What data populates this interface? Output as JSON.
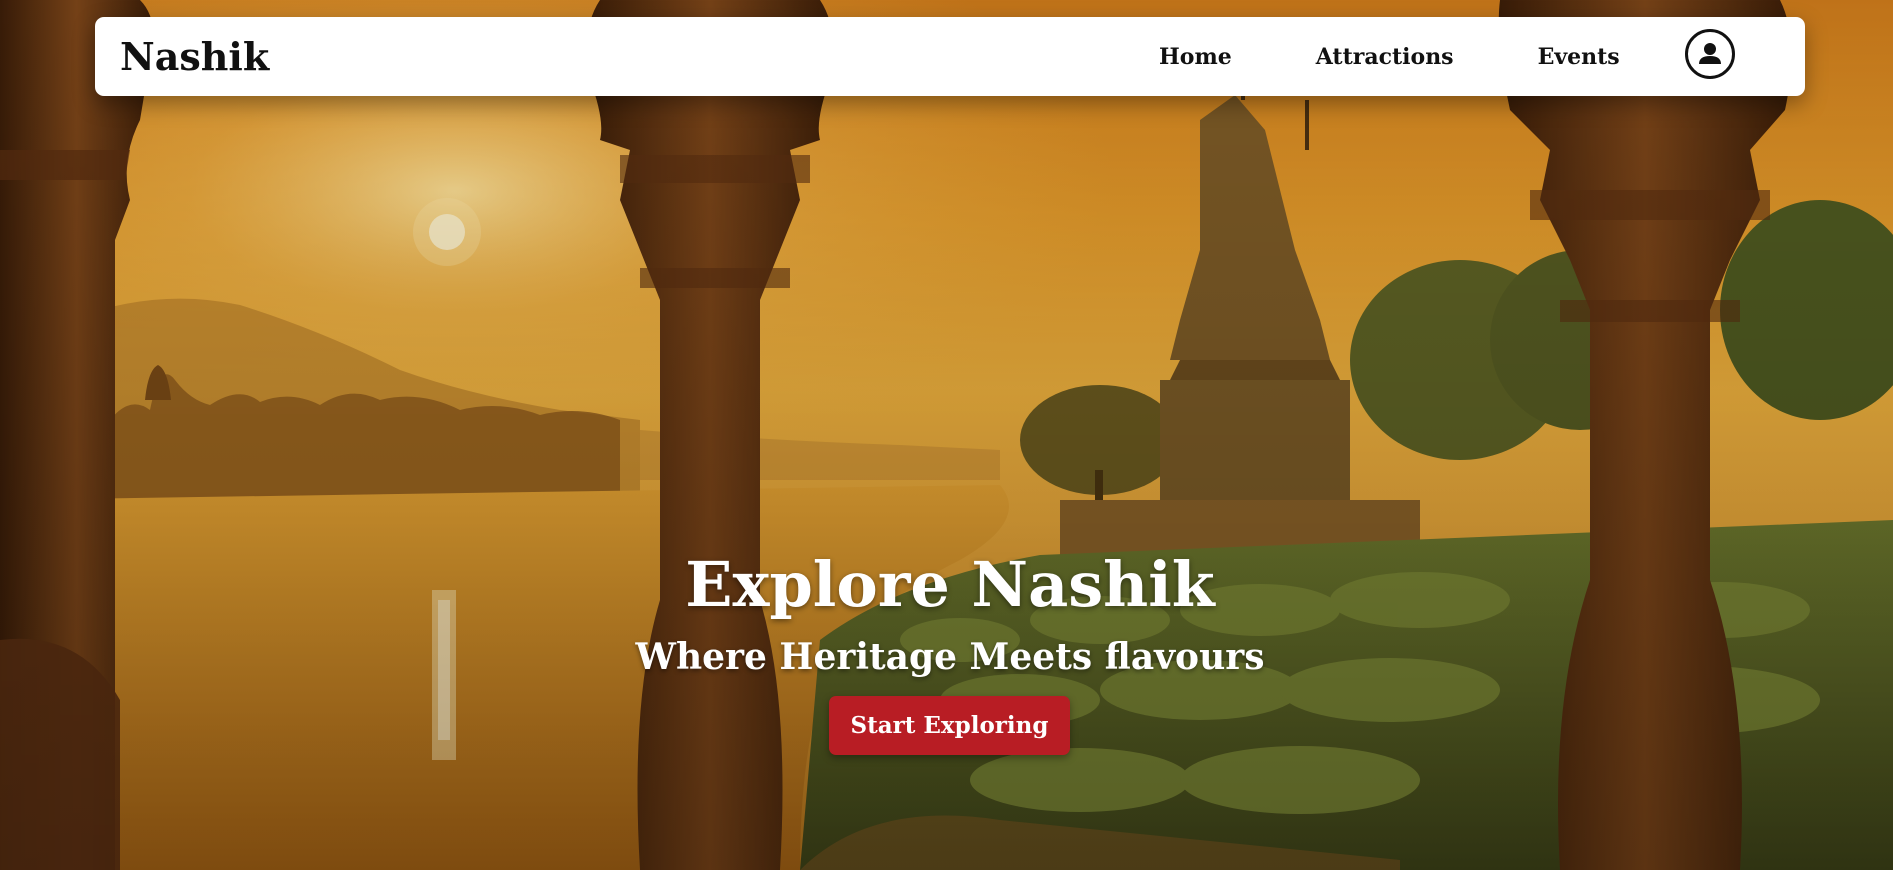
{
  "navbar": {
    "brand": "Nashik",
    "links": [
      {
        "label": "Home"
      },
      {
        "label": "Attractions"
      },
      {
        "label": "Events"
      }
    ],
    "profile_icon": "user-icon"
  },
  "hero": {
    "title": "Explore Nashik",
    "subtitle": "Where Heritage Meets flavours",
    "cta_label": "Start Exploring",
    "cta_color": "#b81d24",
    "background_icon": "sunset-temple-landscape-image"
  }
}
